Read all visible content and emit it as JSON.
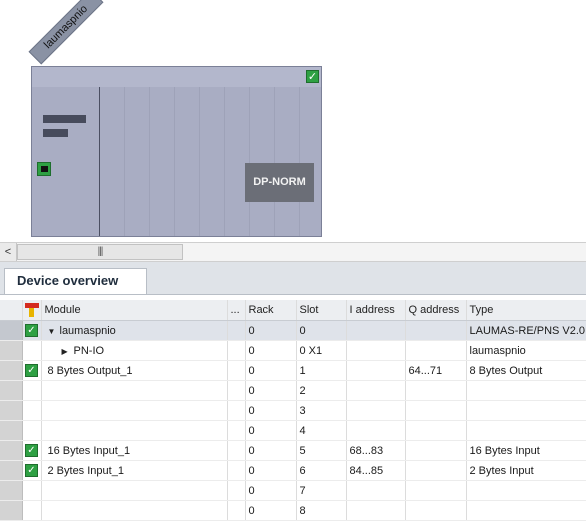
{
  "device": {
    "name": "laumaspnio",
    "module_label": "DP-NORM"
  },
  "scroll": {
    "left_arrow": "<",
    "thumb_grip": "|||"
  },
  "tab": {
    "label": "Device overview"
  },
  "table": {
    "columns": [
      "Module",
      "...",
      "Rack",
      "Slot",
      "I address",
      "Q address",
      "Type"
    ],
    "rows": [
      {
        "check": true,
        "indent": 0,
        "twisty": "▼",
        "module": "laumaspnio",
        "rack": "0",
        "slot": "0",
        "iaddr": "",
        "qaddr": "",
        "type": "LAUMAS-RE/PNS V2.0",
        "selected": true
      },
      {
        "check": false,
        "indent": 1,
        "twisty": "▶",
        "module": "PN-IO",
        "rack": "0",
        "slot": "0 X1",
        "iaddr": "",
        "qaddr": "",
        "type": "laumaspnio",
        "selected": false
      },
      {
        "check": true,
        "indent": 0,
        "twisty": "",
        "module": "8 Bytes Output_1",
        "rack": "0",
        "slot": "1",
        "iaddr": "",
        "qaddr": "64...71",
        "type": "8 Bytes Output",
        "selected": false
      },
      {
        "check": false,
        "indent": 0,
        "twisty": "",
        "module": "",
        "rack": "0",
        "slot": "2",
        "iaddr": "",
        "qaddr": "",
        "type": "",
        "selected": false
      },
      {
        "check": false,
        "indent": 0,
        "twisty": "",
        "module": "",
        "rack": "0",
        "slot": "3",
        "iaddr": "",
        "qaddr": "",
        "type": "",
        "selected": false
      },
      {
        "check": false,
        "indent": 0,
        "twisty": "",
        "module": "",
        "rack": "0",
        "slot": "4",
        "iaddr": "",
        "qaddr": "",
        "type": "",
        "selected": false
      },
      {
        "check": true,
        "indent": 0,
        "twisty": "",
        "module": "16 Bytes Input_1",
        "rack": "0",
        "slot": "5",
        "iaddr": "68...83",
        "qaddr": "",
        "type": "16 Bytes Input",
        "selected": false
      },
      {
        "check": true,
        "indent": 0,
        "twisty": "",
        "module": "2 Bytes Input_1",
        "rack": "0",
        "slot": "6",
        "iaddr": "84...85",
        "qaddr": "",
        "type": "2 Bytes Input",
        "selected": false
      },
      {
        "check": false,
        "indent": 0,
        "twisty": "",
        "module": "",
        "rack": "0",
        "slot": "7",
        "iaddr": "",
        "qaddr": "",
        "type": "",
        "selected": false
      },
      {
        "check": false,
        "indent": 0,
        "twisty": "",
        "module": "",
        "rack": "0",
        "slot": "8",
        "iaddr": "",
        "qaddr": "",
        "type": "",
        "selected": false
      }
    ]
  },
  "colors": {
    "ok": "#2ea043",
    "rack": "#a9adc3",
    "module": "#6b6e77"
  },
  "icons": {
    "status_ok": "checkmark-icon",
    "diag_header": "diagnostics-icon"
  }
}
